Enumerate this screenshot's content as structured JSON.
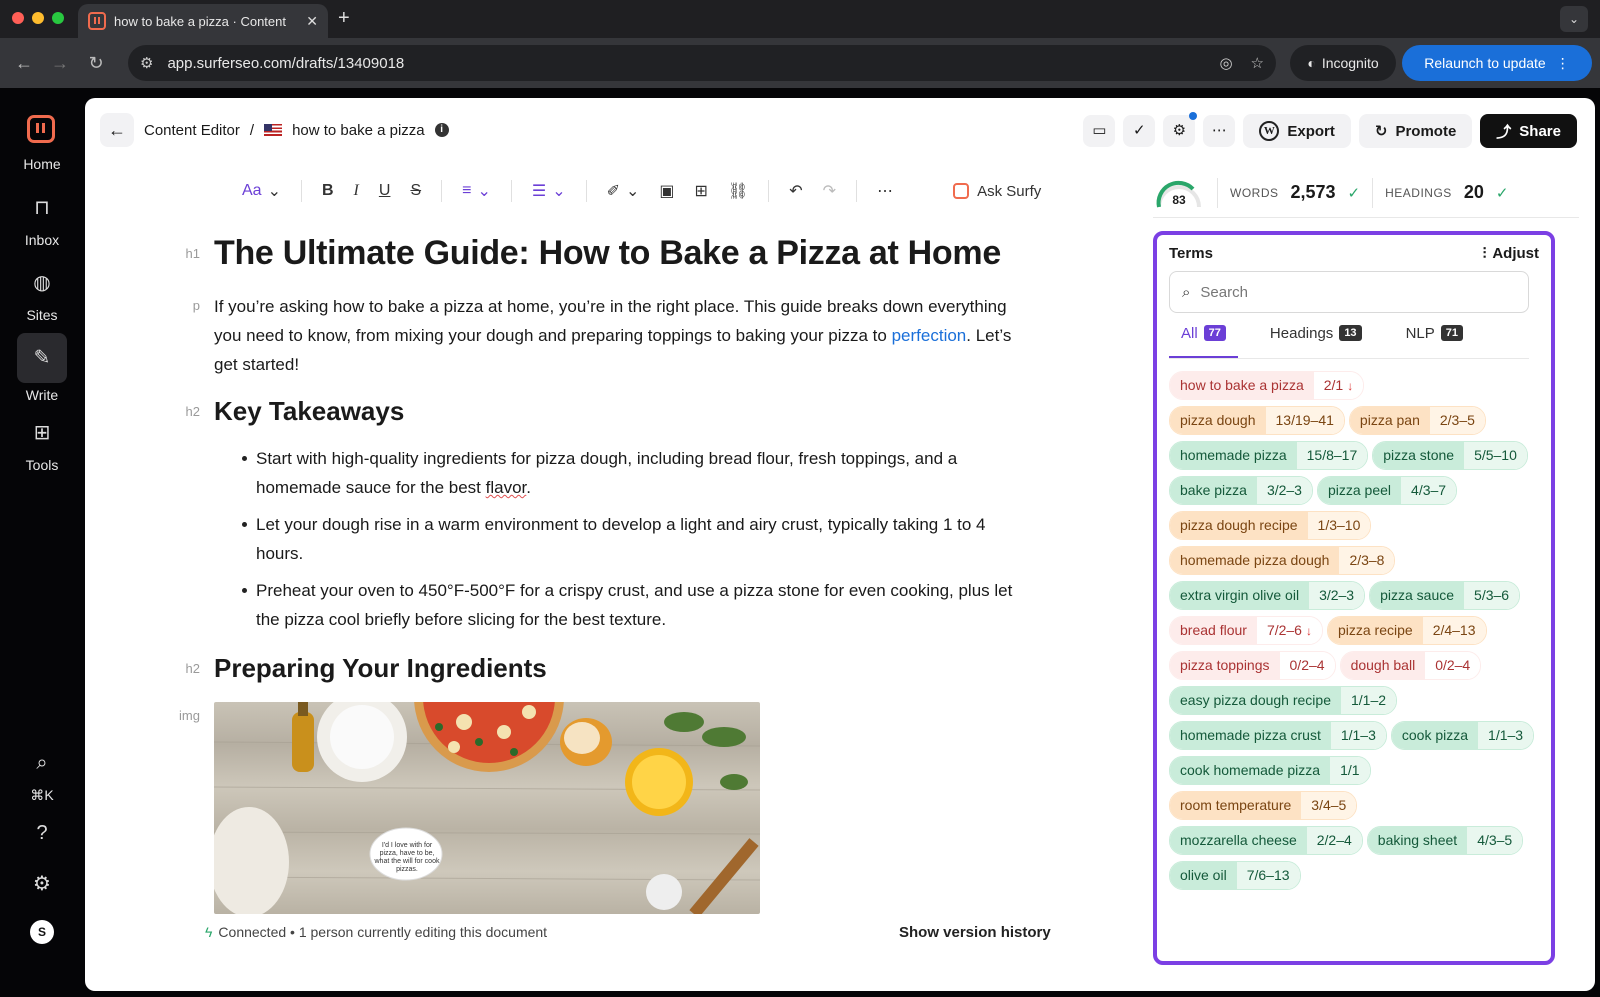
{
  "browser": {
    "tab_title": "how to bake a pizza · Content",
    "url": "app.surferseo.com/drafts/13409018",
    "incognito_label": "Incognito",
    "relaunch_label": "Relaunch to update"
  },
  "leftnav": {
    "items": [
      {
        "label": "Home",
        "icon": "home-icon"
      },
      {
        "label": "Inbox",
        "icon": "inbox-icon"
      },
      {
        "label": "Sites",
        "icon": "globe-icon"
      },
      {
        "label": "Write",
        "icon": "write-icon"
      },
      {
        "label": "Tools",
        "icon": "grid-icon"
      }
    ],
    "shortcut": "⌘K",
    "avatar_letter": "S"
  },
  "header": {
    "section": "Content Editor",
    "separator": "/",
    "doc_title": "how to bake a pizza",
    "export_label": "Export",
    "promote_label": "Promote",
    "share_label": "Share"
  },
  "editor_toolbar": {
    "font_label": "Aa",
    "ask_surfy": "Ask Surfy"
  },
  "document": {
    "h1_tag": "h1",
    "title": "The Ultimate Guide: How to Bake a Pizza at Home",
    "p_tag": "p",
    "intro_pre": "If you’re asking how to bake a pizza at home, you’re in the right place. This guide breaks down everything you need to know, from mixing your dough and preparing toppings to baking your pizza to ",
    "intro_link": "perfection",
    "intro_post": ". Let’s get started!",
    "h2_tag": "h2",
    "h2_takeaways": "Key Takeaways",
    "bullet1_pre": "Start with high-quality ingredients for pizza dough, including bread flour, fresh toppings, and a homemade sauce for the best ",
    "bullet1_squig": "flavor",
    "bullet1_post": ".",
    "bullet2": "Let your dough rise in a warm environment to develop a light and airy crust, typically taking 1 to 4 hours.",
    "bullet3": "Preheat your oven to 450°F-500°F for a crispy crust, and use a pizza stone for even cooking, plus let the pizza cool briefly before slicing for the best texture.",
    "h2_tag2": "h2",
    "h2_ingredients": "Preparing Your Ingredients",
    "img_tag": "img",
    "bubble_text": "I'd I love with for pizza, have to be, what the will for cook pizzas."
  },
  "footer": {
    "status": "Connected • 1 person currently editing this document",
    "version_history": "Show version history"
  },
  "stats": {
    "score": "83",
    "words_label": "WORDS",
    "words_value": "2,573",
    "headings_label": "HEADINGS",
    "headings_value": "20"
  },
  "terms": {
    "title": "Terms",
    "adjust_label": "Adjust",
    "search_placeholder": "Search",
    "tabs": [
      {
        "label": "All",
        "count": "77"
      },
      {
        "label": "Headings",
        "count": "13"
      },
      {
        "label": "NLP",
        "count": "71"
      }
    ],
    "items": [
      {
        "term": "how to bake a pizza",
        "count": "2/1",
        "status": "over"
      },
      {
        "term": "pizza dough",
        "count": "13/19–41",
        "status": "under"
      },
      {
        "term": "pizza pan",
        "count": "2/3–5",
        "status": "under"
      },
      {
        "term": "homemade pizza",
        "count": "15/8–17",
        "status": "good"
      },
      {
        "term": "pizza stone",
        "count": "5/5–10",
        "status": "good"
      },
      {
        "term": "bake pizza",
        "count": "3/2–3",
        "status": "good"
      },
      {
        "term": "pizza peel",
        "count": "4/3–7",
        "status": "good"
      },
      {
        "term": "pizza dough recipe",
        "count": "1/3–10",
        "status": "under"
      },
      {
        "term": "homemade pizza dough",
        "count": "2/3–8",
        "status": "under"
      },
      {
        "term": "extra virgin olive oil",
        "count": "3/2–3",
        "status": "good"
      },
      {
        "term": "pizza sauce",
        "count": "5/3–6",
        "status": "good"
      },
      {
        "term": "bread flour",
        "count": "7/2–6",
        "status": "over"
      },
      {
        "term": "pizza recipe",
        "count": "2/4–13",
        "status": "under"
      },
      {
        "term": "pizza toppings",
        "count": "0/2–4",
        "status": "missing"
      },
      {
        "term": "dough ball",
        "count": "0/2–4",
        "status": "missing"
      },
      {
        "term": "easy pizza dough recipe",
        "count": "1/1–2",
        "status": "good"
      },
      {
        "term": "homemade pizza crust",
        "count": "1/1–3",
        "status": "good"
      },
      {
        "term": "cook pizza",
        "count": "1/1–3",
        "status": "good"
      },
      {
        "term": "cook homemade pizza",
        "count": "1/1",
        "status": "good"
      },
      {
        "term": "room temperature",
        "count": "3/4–5",
        "status": "under"
      },
      {
        "term": "mozzarella cheese",
        "count": "2/2–4",
        "status": "good"
      },
      {
        "term": "baking sheet",
        "count": "4/3–5",
        "status": "good"
      },
      {
        "term": "olive oil",
        "count": "7/6–13",
        "status": "good"
      }
    ]
  },
  "colors": {
    "accent": "#7b3fe4",
    "brand": "#f06b4e",
    "link": "#1a6fd9"
  }
}
